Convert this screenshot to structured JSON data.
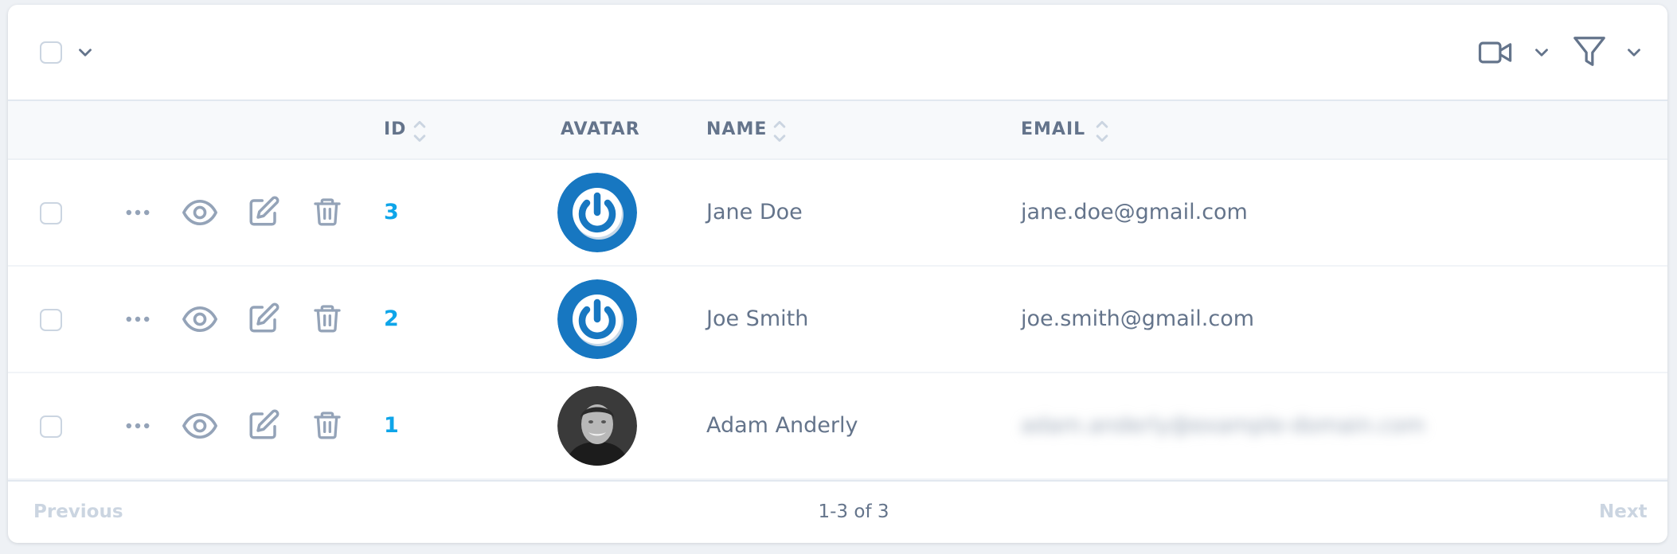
{
  "colors": {
    "accent": "#0ea5e9",
    "icon": "#94a3b8",
    "text": "#64748b",
    "disabled": "#cbd5e1",
    "avatar_blue": "#1777c1"
  },
  "toolbar": {
    "select_all_icon": "chevron-down-icon",
    "actions": [
      {
        "name": "video-icon",
        "dropdown": "chevron-down-icon"
      },
      {
        "name": "filter-icon",
        "dropdown": "chevron-down-icon"
      }
    ]
  },
  "table": {
    "columns": [
      {
        "label": "ID",
        "sortable": true
      },
      {
        "label": "AVATAR",
        "sortable": false
      },
      {
        "label": "NAME",
        "sortable": true
      },
      {
        "label": "EMAIL",
        "sortable": true
      }
    ],
    "row_actions": [
      "more-icon",
      "eye-icon",
      "edit-icon",
      "trash-icon"
    ],
    "rows": [
      {
        "id": "3",
        "avatar": "power-logo",
        "name": "Jane Doe",
        "email": "jane.doe@gmail.com",
        "email_blurred": false
      },
      {
        "id": "2",
        "avatar": "power-logo",
        "name": "Joe Smith",
        "email": "joe.smith@gmail.com",
        "email_blurred": false
      },
      {
        "id": "1",
        "avatar": "photo",
        "name": "Adam Anderly",
        "email": "adam.anderly@example-domain.com",
        "email_blurred": true
      }
    ]
  },
  "pagination": {
    "previous": "Previous",
    "range": "1-3 of 3",
    "next": "Next"
  }
}
